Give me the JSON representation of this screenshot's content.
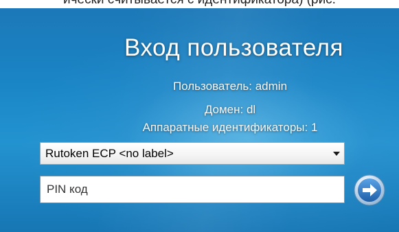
{
  "caption": "ически считывается с идентификатора) (рис.",
  "logon": {
    "title": "Вход пользователя",
    "user_line": "Пользователь: admin",
    "domain_line": "Домен: dl",
    "hardware_line": "Аппаратные идентификаторы: 1",
    "token_select": {
      "selected": "Rutoken ECP <no label>"
    },
    "pin_field": {
      "placeholder": "PIN код",
      "value": ""
    },
    "submit_icon": "arrow-right-icon"
  },
  "colors": {
    "background": "#1a86c6",
    "text": "#ffffff",
    "button": "#2a7fd0"
  }
}
